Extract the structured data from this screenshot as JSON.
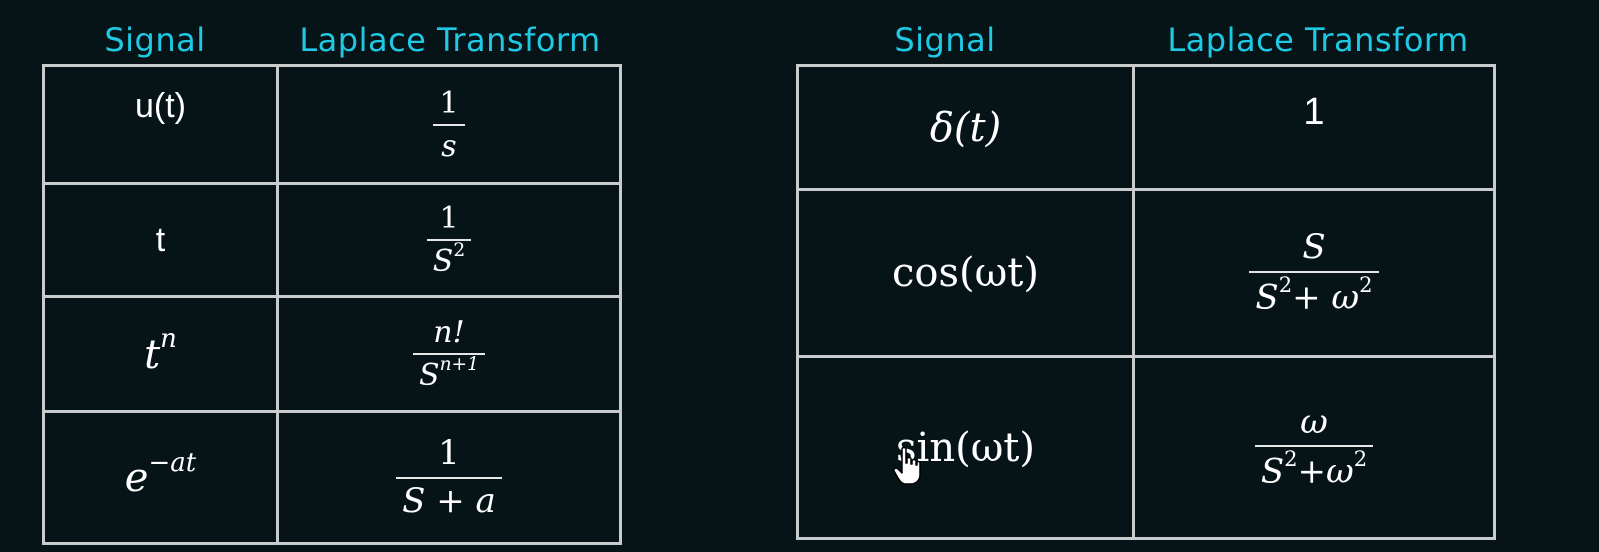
{
  "left_table": {
    "header_signal": "Signal",
    "header_transform": "Laplace Transform",
    "rows": [
      {
        "signal": "u(t)",
        "num": "1",
        "den": "s"
      },
      {
        "signal": "t",
        "num": "1",
        "den_base": "S",
        "den_exp": "2"
      },
      {
        "signal_base": "t",
        "signal_exp": "n",
        "num": "n!",
        "den_base": "S",
        "den_exp": "n+1"
      },
      {
        "signal_base": "e",
        "signal_exp": "−at",
        "num": "1",
        "den": "S + a"
      }
    ]
  },
  "right_table": {
    "header_signal": "Signal",
    "header_transform": "Laplace Transform",
    "rows": [
      {
        "signal": "δ(t)",
        "transform": "1"
      },
      {
        "signal": "cos(ωt)",
        "num": "S",
        "den_a": "S",
        "den_a_exp": "2",
        "den_op": "+ ω",
        "den_b_exp": "2"
      },
      {
        "signal": "sin(ωt)",
        "num": "ω",
        "den_a": "S",
        "den_a_exp": "2",
        "den_op": "+ω",
        "den_b_exp": "2"
      }
    ]
  },
  "icons": {
    "cursor": "hand-pointer-icon"
  }
}
